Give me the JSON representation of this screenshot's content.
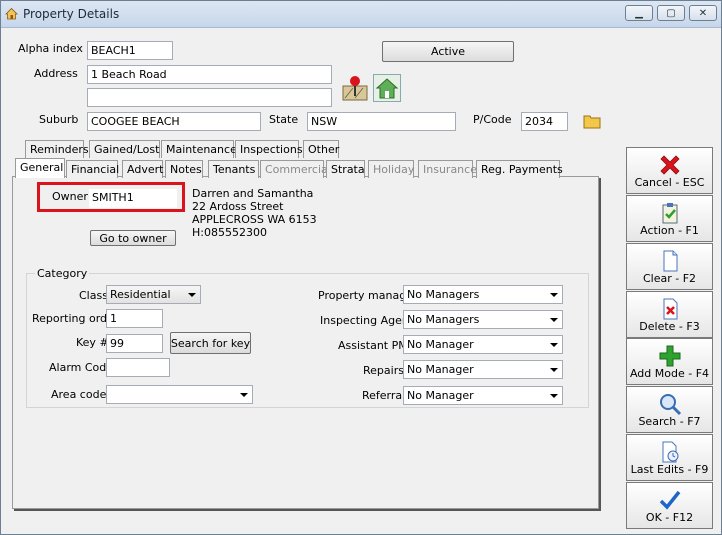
{
  "window": {
    "title": "Property Details",
    "minimize_icon": "minimize-icon",
    "restore_icon": "restore-icon",
    "close_icon": "close-icon"
  },
  "header": {
    "alpha_index_label": "Alpha index",
    "alpha_index_value": "BEACH1",
    "status_button": "Active",
    "address_label": "Address",
    "address_line1": "1 Beach Road",
    "address_line2": "",
    "suburb_label": "Suburb",
    "suburb_value": "COOGEE BEACH",
    "state_label": "State",
    "state_value": "NSW",
    "pcode_label": "P/Code",
    "pcode_value": "2034"
  },
  "tabs_row1": [
    "Reminders",
    "Gained/Lost",
    "Maintenance",
    "Inspections",
    "Other"
  ],
  "tabs_row2": [
    "General",
    "Financial",
    "Advert",
    "Notes",
    "Tenants",
    "Commercial",
    "Strata",
    "Holiday",
    "Insurance",
    "Reg. Payments"
  ],
  "owner": {
    "label": "Owner",
    "value": "SMITH1",
    "name": "Darren and Samantha",
    "street": "22 Ardoss Street",
    "suburb_line": "APPLECROSS  WA 6153",
    "phone": "H:085552300",
    "goto_button": "Go to owner"
  },
  "category": {
    "group_label": "Category",
    "class_label": "Class",
    "class_value": "Residential",
    "reporting_label": "Reporting order",
    "reporting_value": "1",
    "key_label": "Key #",
    "key_value": "99",
    "search_key_button": "Search for key",
    "alarm_label": "Alarm Code",
    "alarm_value": "",
    "area_label": "Area code",
    "area_value": "",
    "pm_label": "Property manager",
    "pm_value": "No Managers",
    "inspecting_label": "Inspecting Agent",
    "inspecting_value": "No Managers",
    "assistant_label": "Assistant PM",
    "assistant_value": "No Manager",
    "repairs_label": "Repairs",
    "repairs_value": "No Manager",
    "referral_label": "Referral",
    "referral_value": "No Manager"
  },
  "side_buttons": [
    {
      "label": "Cancel - ESC",
      "icon": "cancel-x-icon"
    },
    {
      "label": "Action - F1",
      "icon": "action-clipboard-icon"
    },
    {
      "label": "Clear - F2",
      "icon": "clear-page-icon"
    },
    {
      "label": "Delete - F3",
      "icon": "delete-page-icon"
    },
    {
      "label": "Add Mode - F4",
      "icon": "add-plus-icon"
    },
    {
      "label": "Search - F7",
      "icon": "search-magnifier-icon"
    },
    {
      "label": "Last Edits - F9",
      "icon": "last-edits-clock-icon"
    },
    {
      "label": "OK - F12",
      "icon": "ok-check-icon"
    }
  ],
  "colors": {
    "highlight": "#d9141c",
    "cancel": "#d9141c",
    "add": "#2ea12e",
    "ok": "#1f66c9"
  }
}
